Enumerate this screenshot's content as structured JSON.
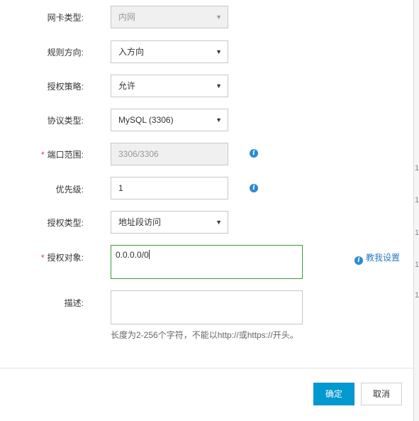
{
  "form": {
    "nic_type": {
      "label": "网卡类型:",
      "value": "内网"
    },
    "direction": {
      "label": "规则方向:",
      "value": "入方向"
    },
    "policy": {
      "label": "授权策略:",
      "value": "允许"
    },
    "protocol": {
      "label": "协议类型:",
      "value": "MySQL (3306)"
    },
    "port_range": {
      "required_mark": "*",
      "label": "端口范围:",
      "value": "3306/3306"
    },
    "priority": {
      "label": "优先级:",
      "value": "1"
    },
    "auth_type": {
      "label": "授权类型:",
      "value": "地址段访问"
    },
    "auth_object": {
      "required_mark": "*",
      "label": "授权对象:",
      "value": "0.0.0.0/0",
      "help_link": "教我设置"
    },
    "description": {
      "label": "描述:",
      "value": "",
      "hint": "长度为2-256个字符，不能以http://或https://开头。"
    }
  },
  "footer": {
    "confirm_label": "确定",
    "cancel_label": "取消"
  },
  "background_fragments": [
    "1",
    "1",
    "1",
    "1",
    "1"
  ],
  "icons": {
    "info": "info-icon",
    "caret": "chevron-down-icon"
  },
  "colors": {
    "primary_button": "#0099d0",
    "required": "#e4393c",
    "focus_border": "#3c9a3c",
    "link": "#2a7ac4",
    "info_icon": "#2a8bd5"
  }
}
